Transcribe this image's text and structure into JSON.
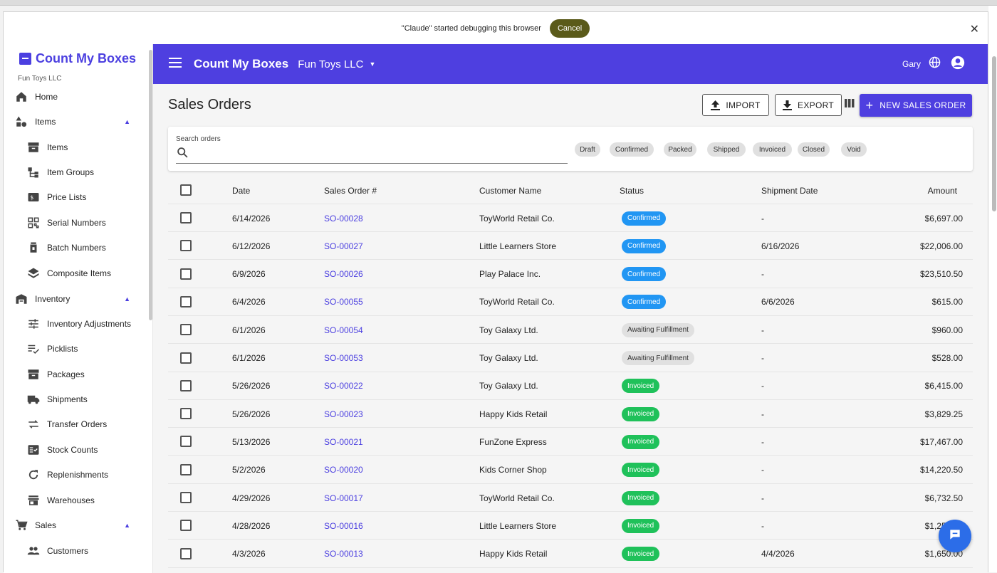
{
  "debug": {
    "message": "\"Claude\" started debugging this browser",
    "cancel_label": "Cancel",
    "close_label": "✕"
  },
  "sidebar": {
    "brand": "Count My Boxes",
    "org": "Fun Toys LLC",
    "items": [
      {
        "label": "Home",
        "icon": "home-icon",
        "level": "top"
      },
      {
        "label": "Items",
        "icon": "shapes-icon",
        "level": "top",
        "expanded": true
      },
      {
        "label": "Items",
        "icon": "archive-icon",
        "level": "sub"
      },
      {
        "label": "Item Groups",
        "icon": "tree-icon",
        "level": "sub"
      },
      {
        "label": "Price Lists",
        "icon": "price-tag-icon",
        "level": "sub"
      },
      {
        "label": "Serial Numbers",
        "icon": "qr-icon",
        "level": "sub"
      },
      {
        "label": "Batch Numbers",
        "icon": "jar-icon",
        "level": "sub"
      },
      {
        "label": "Composite Items",
        "icon": "layers-icon",
        "level": "sub"
      },
      {
        "label": "Inventory",
        "icon": "warehouse-icon",
        "level": "top",
        "expanded": true
      },
      {
        "label": "Inventory Adjustments",
        "icon": "tune-icon",
        "level": "sub"
      },
      {
        "label": "Picklists",
        "icon": "checklist-icon",
        "level": "sub"
      },
      {
        "label": "Packages",
        "icon": "archive-icon",
        "level": "sub"
      },
      {
        "label": "Shipments",
        "icon": "truck-icon",
        "level": "sub"
      },
      {
        "label": "Transfer Orders",
        "icon": "swap-icon",
        "level": "sub"
      },
      {
        "label": "Stock Counts",
        "icon": "fact-check-icon",
        "level": "sub"
      },
      {
        "label": "Replenishments",
        "icon": "refresh-icon",
        "level": "sub"
      },
      {
        "label": "Warehouses",
        "icon": "store-icon",
        "level": "sub"
      },
      {
        "label": "Sales",
        "icon": "cart-icon",
        "level": "top",
        "expanded": true
      },
      {
        "label": "Customers",
        "icon": "people-icon",
        "level": "sub"
      }
    ]
  },
  "header": {
    "title": "Count My Boxes",
    "org": "Fun Toys LLC",
    "user": "Gary"
  },
  "page": {
    "title": "Sales Orders",
    "import_label": "IMPORT",
    "export_label": "EXPORT",
    "new_label": "NEW SALES ORDER",
    "search_label": "Search orders",
    "search_value": "",
    "filters": [
      "Draft",
      "Confirmed",
      "Packed",
      "Shipped",
      "Invoiced",
      "Closed",
      "Void"
    ]
  },
  "table": {
    "columns": [
      "Date",
      "Sales Order #",
      "Customer Name",
      "Status",
      "Shipment Date",
      "Amount"
    ],
    "rows": [
      {
        "date": "6/14/2026",
        "so": "SO-00028",
        "customer": "ToyWorld Retail Co.",
        "status": "Confirmed",
        "ship": "-",
        "amount": "$6,697.00"
      },
      {
        "date": "6/12/2026",
        "so": "SO-00027",
        "customer": "Little Learners Store",
        "status": "Confirmed",
        "ship": "6/16/2026",
        "amount": "$22,006.00"
      },
      {
        "date": "6/9/2026",
        "so": "SO-00026",
        "customer": "Play Palace Inc.",
        "status": "Confirmed",
        "ship": "-",
        "amount": "$23,510.50"
      },
      {
        "date": "6/4/2026",
        "so": "SO-00055",
        "customer": "ToyWorld Retail Co.",
        "status": "Confirmed",
        "ship": "6/6/2026",
        "amount": "$615.00"
      },
      {
        "date": "6/1/2026",
        "so": "SO-00054",
        "customer": "Toy Galaxy Ltd.",
        "status": "Awaiting Fulfillment",
        "ship": "-",
        "amount": "$960.00"
      },
      {
        "date": "6/1/2026",
        "so": "SO-00053",
        "customer": "Toy Galaxy Ltd.",
        "status": "Awaiting Fulfillment",
        "ship": "-",
        "amount": "$528.00"
      },
      {
        "date": "5/26/2026",
        "so": "SO-00022",
        "customer": "Toy Galaxy Ltd.",
        "status": "Invoiced",
        "ship": "-",
        "amount": "$6,415.00"
      },
      {
        "date": "5/26/2026",
        "so": "SO-00023",
        "customer": "Happy Kids Retail",
        "status": "Invoiced",
        "ship": "-",
        "amount": "$3,829.25"
      },
      {
        "date": "5/13/2026",
        "so": "SO-00021",
        "customer": "FunZone Express",
        "status": "Invoiced",
        "ship": "-",
        "amount": "$17,467.00"
      },
      {
        "date": "5/2/2026",
        "so": "SO-00020",
        "customer": "Kids Corner Shop",
        "status": "Invoiced",
        "ship": "-",
        "amount": "$14,220.50"
      },
      {
        "date": "4/29/2026",
        "so": "SO-00017",
        "customer": "ToyWorld Retail Co.",
        "status": "Invoiced",
        "ship": "-",
        "amount": "$6,732.50"
      },
      {
        "date": "4/28/2026",
        "so": "SO-00016",
        "customer": "Little Learners Store",
        "status": "Invoiced",
        "ship": "-",
        "amount": "$1,255.00"
      },
      {
        "date": "4/3/2026",
        "so": "SO-00013",
        "customer": "Happy Kids Retail",
        "status": "Invoiced",
        "ship": "4/4/2026",
        "amount": "$1,650.00"
      }
    ]
  },
  "colors": {
    "accent": "#4e3fe0",
    "confirmed": "#2196f3",
    "invoiced": "#1fc15a",
    "awaiting": "#e0e0e0"
  }
}
